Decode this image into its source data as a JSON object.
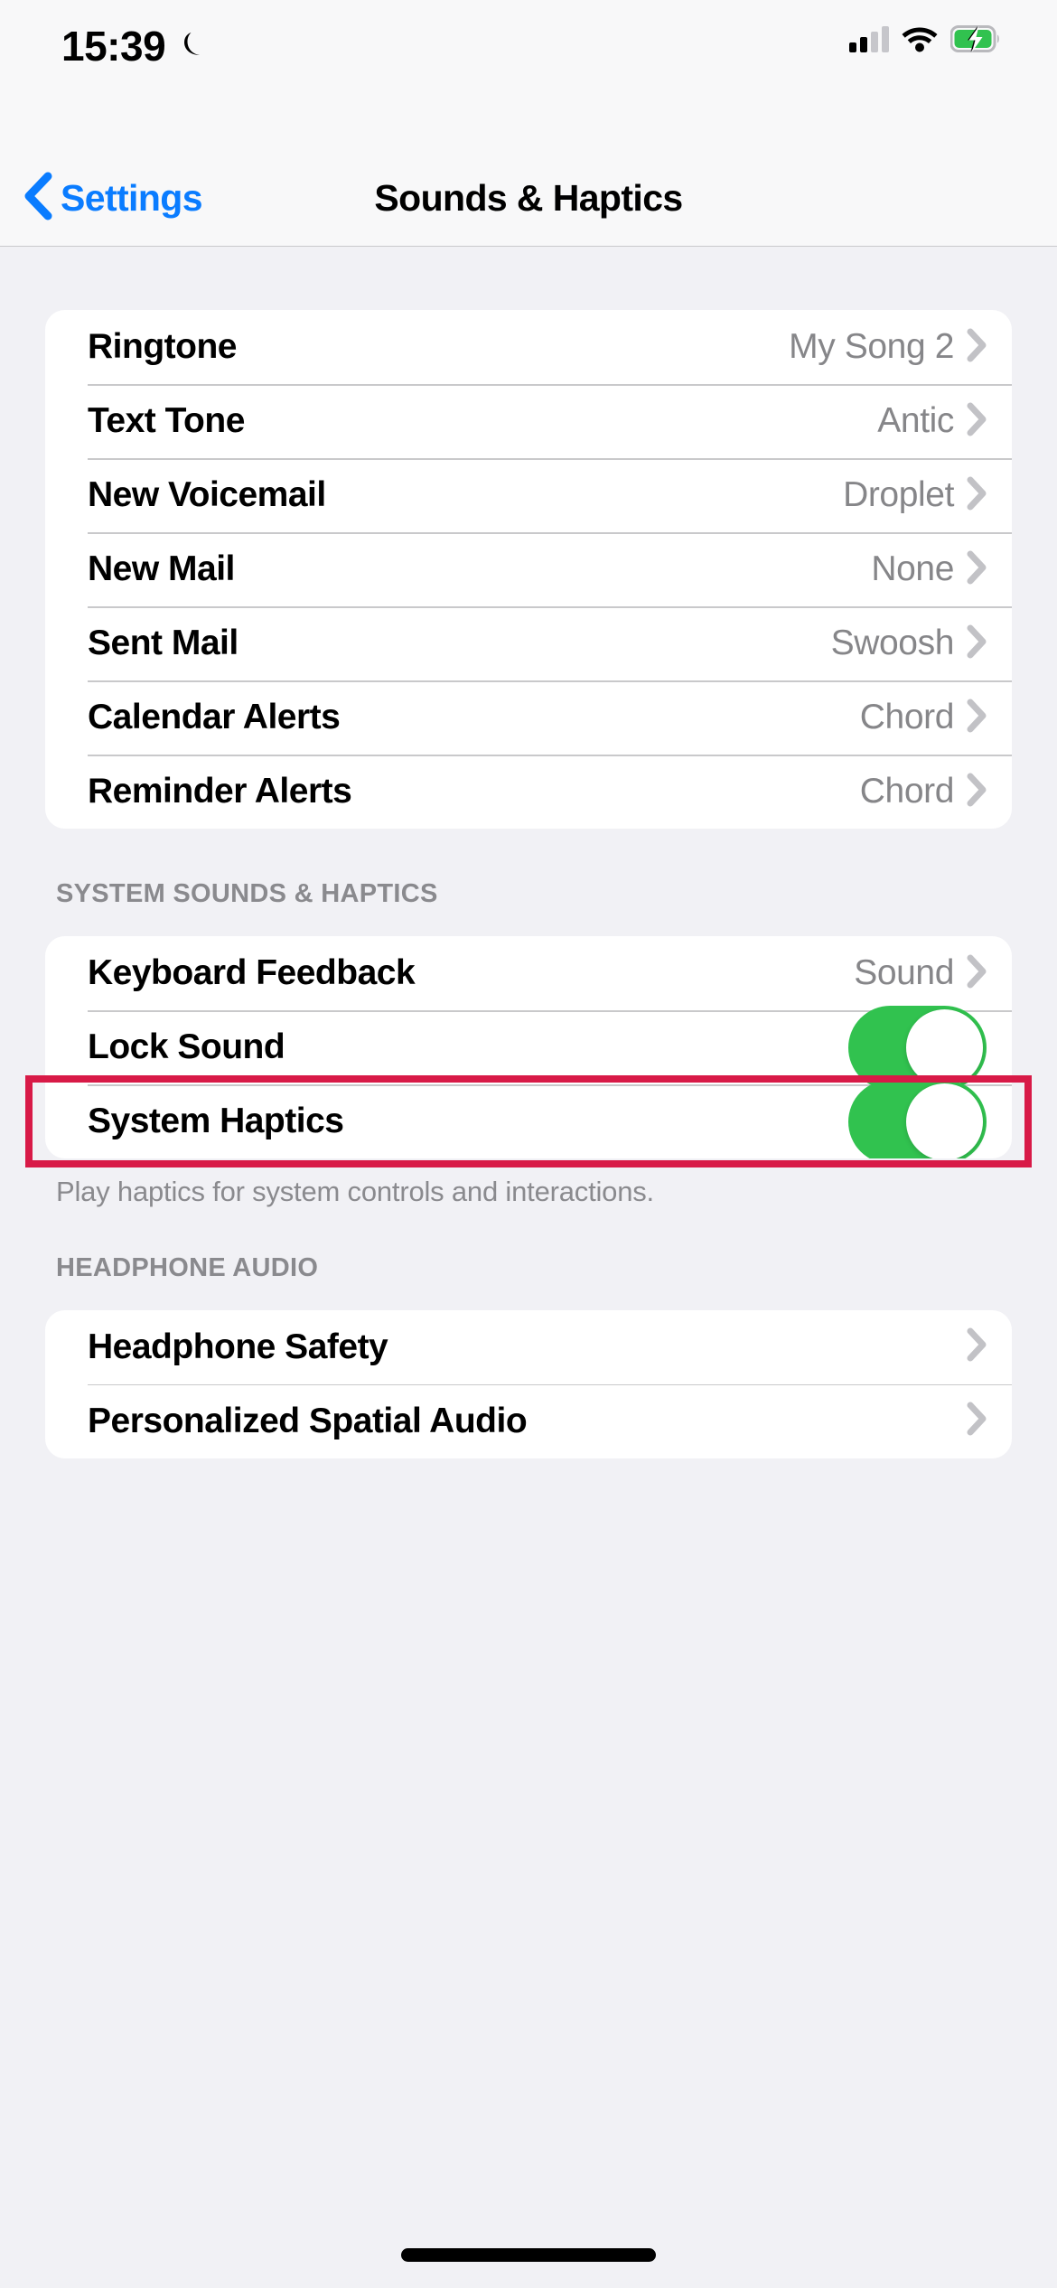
{
  "status_bar": {
    "time": "15:39",
    "moon_icon": "crescent-moon-icon",
    "cellular_icon": "cellular-signal-icon",
    "wifi_icon": "wifi-icon",
    "battery_icon": "battery-charging-icon"
  },
  "nav": {
    "back_icon": "chevron-left-icon",
    "back_label": "Settings",
    "title": "Sounds & Haptics"
  },
  "colors": {
    "accent_blue": "#0a7cff",
    "toggle_on_green": "#31c24f",
    "highlight_red": "#d81a47",
    "page_background": "#f1f1f5",
    "card_background": "#ffffff",
    "value_gray": "#868689",
    "header_gray": "#8a8a8e"
  },
  "sections": [
    {
      "header": "",
      "footer": "",
      "rows": [
        {
          "label": "Ringtone",
          "value": "My Song 2",
          "type": "disclosure"
        },
        {
          "label": "Text Tone",
          "value": "Antic",
          "type": "disclosure"
        },
        {
          "label": "New Voicemail",
          "value": "Droplet",
          "type": "disclosure"
        },
        {
          "label": "New Mail",
          "value": "None",
          "type": "disclosure"
        },
        {
          "label": "Sent Mail",
          "value": "Swoosh",
          "type": "disclosure"
        },
        {
          "label": "Calendar Alerts",
          "value": "Chord",
          "type": "disclosure"
        },
        {
          "label": "Reminder Alerts",
          "value": "Chord",
          "type": "disclosure"
        }
      ]
    },
    {
      "header": "SYSTEM SOUNDS & HAPTICS",
      "footer": "Play haptics for system controls and interactions.",
      "rows": [
        {
          "label": "Keyboard Feedback",
          "value": "Sound",
          "type": "disclosure"
        },
        {
          "label": "Lock Sound",
          "value": "on",
          "type": "toggle"
        },
        {
          "label": "System Haptics",
          "value": "on",
          "type": "toggle",
          "highlighted": true
        }
      ]
    },
    {
      "header": "HEADPHONE AUDIO",
      "footer": "",
      "rows": [
        {
          "label": "Headphone Safety",
          "value": "",
          "type": "disclosure"
        },
        {
          "label": "Personalized Spatial Audio",
          "value": "",
          "type": "disclosure"
        }
      ]
    }
  ],
  "home_indicator": "home-indicator"
}
